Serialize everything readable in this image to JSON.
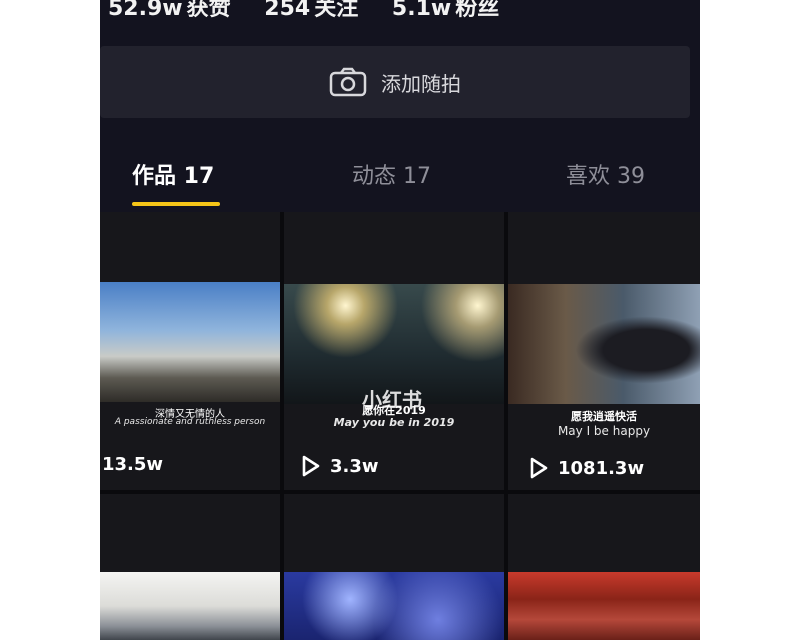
{
  "profile": {
    "stats": [
      {
        "value": "52.9w",
        "label": "获赞"
      },
      {
        "value": "254",
        "label": "关注"
      },
      {
        "value": "5.1w",
        "label": "粉丝"
      }
    ],
    "add_post_label": "添加随拍"
  },
  "tabs": [
    {
      "label": "作品 17",
      "active": true
    },
    {
      "label": "动态 17",
      "active": false
    },
    {
      "label": "喜欢 39",
      "active": false
    }
  ],
  "videos": [
    {
      "caption_cn": "深情又无情的人",
      "caption_en": "A passionate and ruthless person",
      "plays": "13.5w"
    },
    {
      "caption_cn": "愿你在2019",
      "caption_en": "May you be in 2019",
      "plays": "3.3w",
      "watermark": "小红书"
    },
    {
      "caption_cn": "愿我逍遥快活",
      "caption_en": "May I be happy",
      "plays": "1081.3w"
    }
  ],
  "colors": {
    "background": "#13131f",
    "tab_indicator": "#f5c518",
    "post_bar": "#22222d"
  }
}
